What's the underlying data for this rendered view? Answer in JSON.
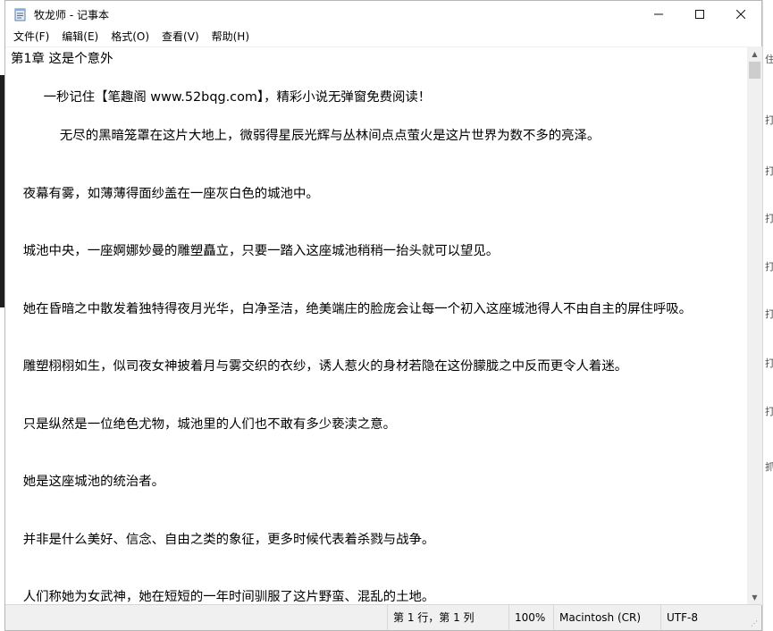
{
  "window": {
    "title": "牧龙师 - 记事本",
    "controls": {
      "minimize": "—",
      "maximize": "☐",
      "close": "✕"
    }
  },
  "menu": {
    "items": [
      "文件(F)",
      "编辑(E)",
      "格式(O)",
      "查看(V)",
      "帮助(H)"
    ]
  },
  "document": {
    "lines": [
      "第1章 这是个意外",
      "",
      "        一秒记住【笔趣阁 www.52bqg.com】，精彩小说无弹窗免费阅读！",
      "",
      "            无尽的黑暗笼罩在这片大地上，微弱得星辰光辉与丛林间点点萤火是这片世界为数不多的亮泽。",
      "",
      "",
      "   夜幕有雾，如薄薄得面纱盖在一座灰白色的城池中。",
      "",
      "",
      "   城池中央，一座婀娜妙曼的雕塑矗立，只要一踏入这座城池稍稍一抬头就可以望见。",
      "",
      "",
      "   她在昏暗之中散发着独特得夜月光华，白净圣洁，绝美端庄的脸庞会让每一个初入这座城池得人不由自主的屏住呼吸。",
      "",
      "",
      "   雕塑栩栩如生，似司夜女神披着月与雾交织的衣纱，诱人惹火的身材若隐在这份朦胧之中反而更令人着迷。",
      "",
      "",
      "   只是纵然是一位绝色尤物，城池里的人们也不敢有多少亵渎之意。",
      "",
      "",
      "   她是这座城池的统治者。",
      "",
      "",
      "   并非是什么美好、信念、自由之类的象征，更多时候代表着杀戮与战争。",
      "",
      "",
      "   人们称她为女武神，她在短短的一年时间驯服了这片野蛮、混乱的土地。"
    ]
  },
  "status": {
    "position": "第 1 行，第 1 列",
    "zoom": "100%",
    "line_ending": "Macintosh (CR)",
    "encoding": "UTF-8"
  },
  "icons": {
    "app": "notepad-icon",
    "scroll_up": "scroll-up-arrow-icon",
    "scroll_down": "scroll-down-arrow-icon",
    "resize": "resize-grip-icon"
  },
  "background_marks": [
    "住",
    "打",
    "打",
    "打",
    "打",
    "打",
    "打",
    "打",
    "抓"
  ]
}
